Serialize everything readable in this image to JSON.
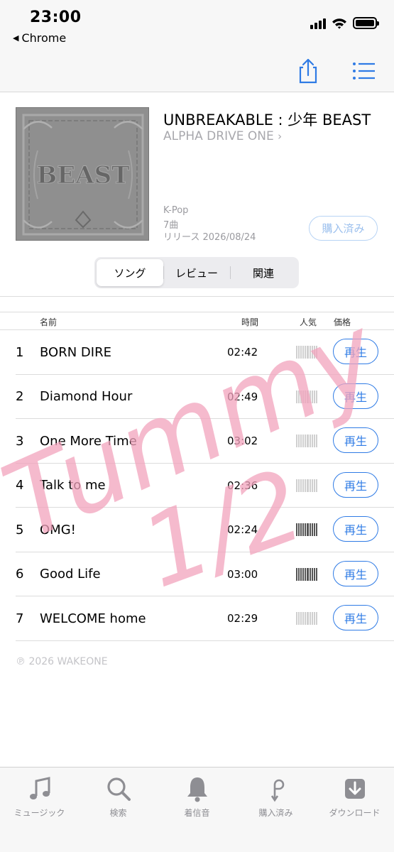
{
  "status_bar": {
    "time": "23:00",
    "back_app": "Chrome"
  },
  "album": {
    "title": "UNBREAKABLE : 少年 BEAST",
    "artist": "ALPHA DRIVE ONE",
    "genre": "K-Pop",
    "track_count": "7曲",
    "release": "リリース 2026/08/24",
    "purchase_status": "購入済み",
    "cover_text": "BEAST"
  },
  "segments": [
    "ソング",
    "レビュー",
    "関連"
  ],
  "table_header": {
    "name": "名前",
    "time": "時間",
    "popularity": "人気",
    "price": "価格"
  },
  "tracks": [
    {
      "num": "1",
      "name": "BORN DIRE",
      "duration": "02:42",
      "popularity": 0.2,
      "action": "再生"
    },
    {
      "num": "2",
      "name": "Diamond Hour",
      "duration": "02:49",
      "popularity": 0.2,
      "action": "再生"
    },
    {
      "num": "3",
      "name": "One More Time",
      "duration": "03:02",
      "popularity": 0.2,
      "action": "再生"
    },
    {
      "num": "4",
      "name": "Talk to me",
      "duration": "02:36",
      "popularity": 0.2,
      "action": "再生"
    },
    {
      "num": "5",
      "name": "OMG!",
      "duration": "02:24",
      "popularity": 1.0,
      "action": "再生"
    },
    {
      "num": "6",
      "name": "Good Life",
      "duration": "03:00",
      "popularity": 1.0,
      "action": "再生"
    },
    {
      "num": "7",
      "name": "WELCOME home",
      "duration": "02:29",
      "popularity": 0.2,
      "action": "再生"
    }
  ],
  "copyright": "℗ 2026 WAKEONE",
  "watermark": {
    "line1": "Tummy",
    "line2": "1/2",
    "color": "#f2a3bc"
  },
  "tab_bar": [
    {
      "label": "ミュージック",
      "icon": "music-note-icon"
    },
    {
      "label": "検索",
      "icon": "search-icon"
    },
    {
      "label": "着信音",
      "icon": "bell-icon"
    },
    {
      "label": "購入済み",
      "icon": "purchased-icon"
    },
    {
      "label": "ダウンロード",
      "icon": "download-icon"
    }
  ],
  "colors": {
    "accent": "#2f7be5",
    "secondary_text": "#a8a8ad"
  }
}
